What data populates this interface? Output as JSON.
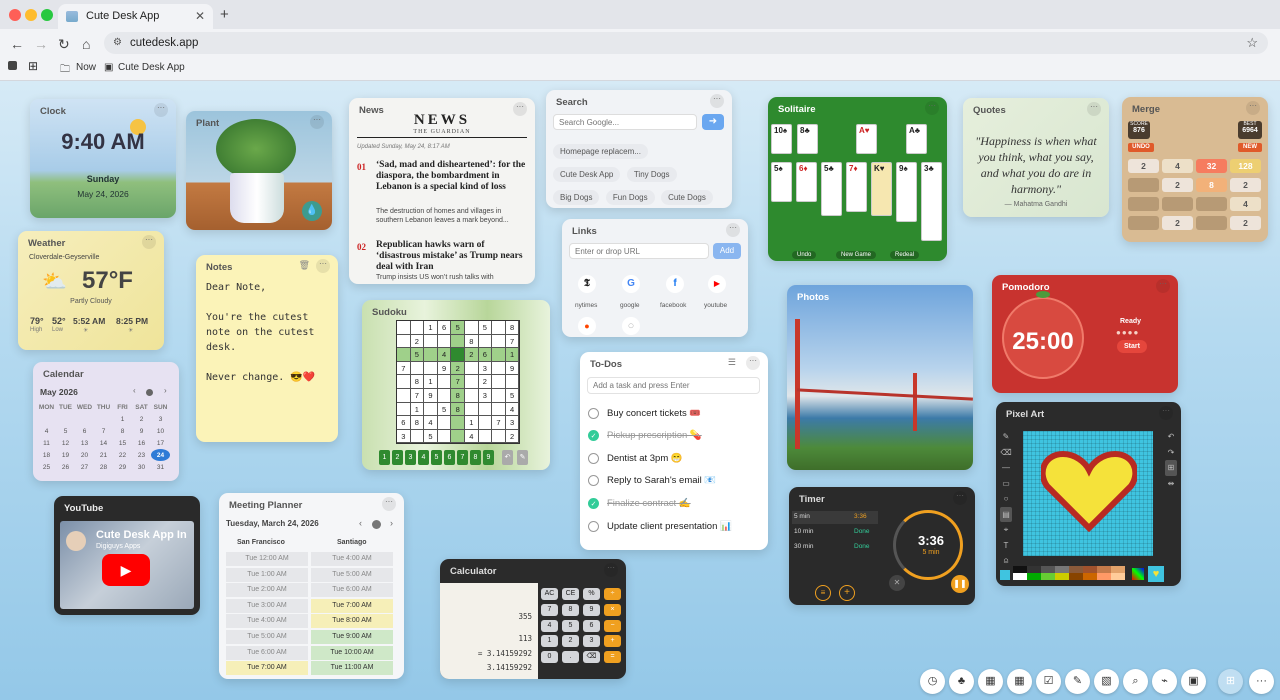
{
  "browser": {
    "tab_title": "Cute Desk App",
    "url": "cutedesk.app",
    "bookmarks": [
      "Now",
      "Cute Desk App"
    ]
  },
  "clock": {
    "title": "Clock",
    "time": "9:40 AM",
    "day": "Sunday",
    "date": "May 24, 2026"
  },
  "plant": {
    "title": "Plant"
  },
  "news": {
    "title": "News",
    "masthead": "NEWS",
    "source": "THE GUARDIAN",
    "updated": "Updated Sunday, May 24, 8:17 AM",
    "items": [
      {
        "num": "01",
        "headline": "‘Sad, mad and disheartened’: for the diaspora, the bombardment in Lebanon is a special kind of loss",
        "summary": "The destruction of homes and villages in southern Lebanon leaves a mark beyond..."
      },
      {
        "num": "02",
        "headline": "Republican hawks warn of ‘disastrous mistake’ as Trump nears deal with Iran",
        "summary": "Trump insists US won’t rush talks with"
      }
    ]
  },
  "search": {
    "title": "Search",
    "placeholder": "Search Google...",
    "chips": [
      "Homepage replacem...",
      "Cute Desk App",
      "Tiny Dogs",
      "Big Dogs",
      "Fun Dogs",
      "Cute Dogs"
    ]
  },
  "links": {
    "title": "Links",
    "placeholder": "Enter or drop URL",
    "add": "Add",
    "sites": [
      "nytimes",
      "google",
      "facebook",
      "youtube"
    ]
  },
  "solitaire": {
    "title": "Solitaire",
    "buttons": [
      "Undo",
      "New Game",
      "Redeal"
    ]
  },
  "quotes": {
    "title": "Quotes",
    "quote": "\"Happiness is when what you think, what you say, and what you do are in harmony.\"",
    "author": "— Mahatma Gandhi"
  },
  "merge": {
    "title": "Merge",
    "score_label": "SCORE",
    "score": "876",
    "best_label": "BEST",
    "best": "6964",
    "undo": "UNDO",
    "new": "NEW",
    "grid": [
      [
        "2",
        "4",
        "32",
        "128"
      ],
      [
        "",
        "2",
        "8",
        "2"
      ],
      [
        "",
        "",
        "",
        "4"
      ],
      [
        "",
        "2",
        "",
        "2"
      ]
    ]
  },
  "weather": {
    "title": "Weather",
    "location": "Cloverdale-Geyserville",
    "temp": "57°F",
    "condition": "Partly Cloudy",
    "high": "79°",
    "high_label": "High",
    "low": "52°",
    "low_label": "Low",
    "sunrise": "5:52 AM",
    "sunset": "8:25 PM"
  },
  "notes": {
    "title": "Notes",
    "lines": [
      "Dear Note,",
      "",
      "You're the cutest",
      "note on the cutest",
      "desk.",
      "",
      "Never change. 😎❤️"
    ]
  },
  "sudoku": {
    "title": "Sudoku",
    "numbers": [
      "1",
      "2",
      "3",
      "4",
      "5",
      "6",
      "7",
      "8",
      "9"
    ]
  },
  "calendar": {
    "title": "Calendar",
    "month": "May 2026",
    "days": [
      "MON",
      "TUE",
      "WED",
      "THU",
      "FRI",
      "SAT",
      "SUN"
    ],
    "weeks": [
      [
        "",
        "",
        "",
        "",
        "1",
        "2",
        "3"
      ],
      [
        "4",
        "5",
        "6",
        "7",
        "8",
        "9",
        "10"
      ],
      [
        "11",
        "12",
        "13",
        "14",
        "15",
        "16",
        "17"
      ],
      [
        "18",
        "19",
        "20",
        "21",
        "22",
        "23",
        "24"
      ],
      [
        "25",
        "26",
        "27",
        "28",
        "29",
        "30",
        "31"
      ]
    ]
  },
  "todos": {
    "title": "To-Dos",
    "placeholder": "Add a task and press Enter",
    "items": [
      {
        "text": "Buy concert tickets 🎟️",
        "done": false
      },
      {
        "text": "Pickup prescription 💊",
        "done": true
      },
      {
        "text": "Dentist at 3pm 😁",
        "done": false
      },
      {
        "text": "Reply to Sarah's email 📧",
        "done": false
      },
      {
        "text": "Finalize contract ✍️",
        "done": true
      },
      {
        "text": "Update client presentation 📊",
        "done": false
      }
    ]
  },
  "photos": {
    "title": "Photos"
  },
  "pomodoro": {
    "title": "Pomodoro",
    "time": "25:00",
    "status": "Ready",
    "start": "Start"
  },
  "youtube": {
    "title": "YouTube",
    "video_title": "Cute Desk App In",
    "channel": "Digiguys Apps"
  },
  "meeting": {
    "title": "Meeting Planner",
    "date": "Tuesday, March 24, 2026",
    "cities": [
      "San Francisco",
      "Santiago"
    ],
    "rows": [
      [
        "Tue 12:00 AM",
        "Tue 4:00 AM"
      ],
      [
        "Tue 1:00 AM",
        "Tue 5:00 AM"
      ],
      [
        "Tue 2:00 AM",
        "Tue 6:00 AM"
      ],
      [
        "Tue 3:00 AM",
        "Tue 7:00 AM"
      ],
      [
        "Tue 4:00 AM",
        "Tue 8:00 AM"
      ],
      [
        "Tue 5:00 AM",
        "Tue 9:00 AM"
      ],
      [
        "Tue 6:00 AM",
        "Tue 10:00 AM"
      ],
      [
        "Tue 7:00 AM",
        "Tue 11:00 AM"
      ]
    ]
  },
  "calculator": {
    "title": "Calculator",
    "tape": [
      "355",
      "113",
      "= 3.14159292",
      "3.14159292"
    ],
    "keys": [
      [
        "AC",
        "CE",
        "%",
        "÷"
      ],
      [
        "7",
        "8",
        "9",
        "×"
      ],
      [
        "4",
        "5",
        "6",
        "−"
      ],
      [
        "1",
        "2",
        "3",
        "+"
      ],
      [
        "0",
        ".",
        "⌫",
        "="
      ]
    ]
  },
  "timer": {
    "title": "Timer",
    "time": "3:36",
    "sub": "5 min",
    "rows": [
      [
        "5 min",
        "3:36"
      ],
      [
        "10 min",
        "Done"
      ],
      [
        "30 min",
        "Done"
      ]
    ]
  },
  "pixel": {
    "title": "Pixel Art"
  },
  "colors": {
    "clock_bg": "#c4ddf0",
    "notes_bg": "#fbf3b8",
    "pomodoro_bg": "#c8332f",
    "solitaire_bg": "#2e8a2e",
    "merge_bg": "#d9bb93",
    "timer_bg": "#2a2a2a",
    "pixel_bg": "#2b2b2b",
    "accent": "#5aa0f0"
  }
}
